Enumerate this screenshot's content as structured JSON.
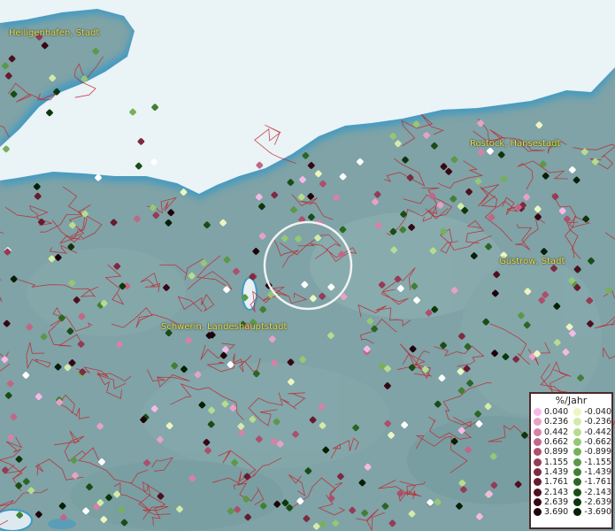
{
  "map": {
    "cities": [
      {
        "id": "heiligenhafen",
        "label": "Heiligenhafen, Stadt"
      },
      {
        "id": "rostock",
        "label": "Rostock, Hansestadt"
      },
      {
        "id": "guestrow",
        "label": "Güstrow, Stadt"
      },
      {
        "id": "schwerin",
        "label": "Schwerin, Landeshauptstadt"
      }
    ],
    "colors": {
      "land": "#7fa3a6",
      "sea": "#eaf3f6",
      "coast_glow": "#3f9ac4",
      "borders": "#c0262f",
      "selection_ring": "#f2f2f2"
    }
  },
  "legend": {
    "title": "%/Jahr",
    "positive": [
      {
        "label": "0.040",
        "color": "#f6b9e6"
      },
      {
        "label": "0.236",
        "color": "#e9a0c6"
      },
      {
        "label": "0.442",
        "color": "#d881a6"
      },
      {
        "label": "0.662",
        "color": "#c26688"
      },
      {
        "label": "0.899",
        "color": "#ad4f6d"
      },
      {
        "label": "1.155",
        "color": "#963b55"
      },
      {
        "label": "1.439",
        "color": "#7e2a41"
      },
      {
        "label": "1.761",
        "color": "#661b2f"
      },
      {
        "label": "2.143",
        "color": "#4d1020"
      },
      {
        "label": "2.639",
        "color": "#360814"
      },
      {
        "label": "3.690",
        "color": "#1e030a"
      }
    ],
    "negative": [
      {
        "label": "-0.040",
        "color": "#edf6c0"
      },
      {
        "label": "-0.236",
        "color": "#d3eba9"
      },
      {
        "label": "-0.442",
        "color": "#b7dc8e"
      },
      {
        "label": "-0.662",
        "color": "#96c774"
      },
      {
        "label": "-0.899",
        "color": "#77b05c"
      },
      {
        "label": "-1.155",
        "color": "#5b9848"
      },
      {
        "label": "-1.439",
        "color": "#427f35"
      },
      {
        "label": "-1.761",
        "color": "#2c6624"
      },
      {
        "label": "-2.143",
        "color": "#1a4d16"
      },
      {
        "label": "-2.639",
        "color": "#0e360c"
      },
      {
        "label": "-3.690",
        "color": "#061f05"
      }
    ]
  }
}
